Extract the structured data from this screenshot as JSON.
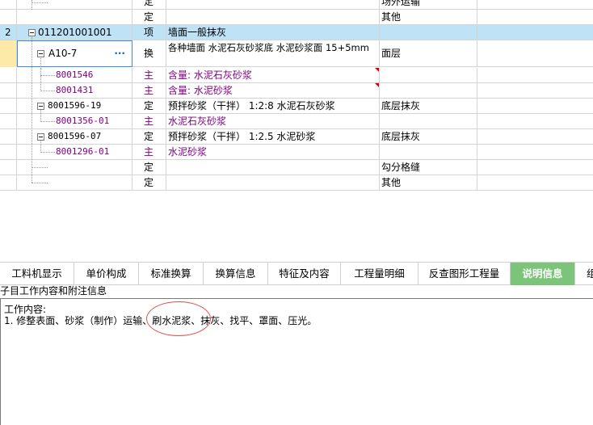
{
  "grid": {
    "rows": [
      {
        "num": "",
        "code": "",
        "type": "定",
        "name": "",
        "feature": "场外运输",
        "purple": false
      },
      {
        "num": "",
        "code": "",
        "type": "定",
        "name": "",
        "feature": "其他",
        "purple": false
      },
      {
        "num": "2",
        "code": "011201001001",
        "type": "项",
        "name": "墙面一般抹灰",
        "feature": "",
        "purple": false
      },
      {
        "num": "",
        "code": "A10-7",
        "type": "换",
        "name": "各种墙面 水泥石灰砂浆底 水泥砂浆面 15+5mm",
        "feature": "面层",
        "purple": false,
        "more_label": "···"
      },
      {
        "num": "",
        "code": "8001546",
        "type": "主",
        "name": "含量: 水泥石灰砂浆",
        "feature": "",
        "purple": true
      },
      {
        "num": "",
        "code": "8001431",
        "type": "主",
        "name": "含量: 水泥砂浆",
        "feature": "",
        "purple": true
      },
      {
        "num": "",
        "code": "8001596-19",
        "type": "定",
        "name": "预拌砂浆（干拌） 1:2:8 水泥石灰砂浆",
        "feature": "底层抹灰",
        "purple": false
      },
      {
        "num": "",
        "code": "8001356-01",
        "type": "主",
        "name": "水泥石灰砂浆",
        "feature": "",
        "purple": true
      },
      {
        "num": "",
        "code": "8001596-07",
        "type": "定",
        "name": "预拌砂浆（干拌） 1:2.5 水泥砂浆",
        "feature": "底层抹灰",
        "purple": false
      },
      {
        "num": "",
        "code": "8001296-01",
        "type": "主",
        "name": "水泥砂浆",
        "feature": "",
        "purple": true
      },
      {
        "num": "",
        "code": "",
        "type": "定",
        "name": "",
        "feature": "勾分格缝",
        "purple": false
      },
      {
        "num": "",
        "code": "",
        "type": "定",
        "name": "",
        "feature": "其他",
        "purple": false
      }
    ]
  },
  "tabs": [
    {
      "label": "工料机显示",
      "active": false
    },
    {
      "label": "单价构成",
      "active": false
    },
    {
      "label": "标准换算",
      "active": false
    },
    {
      "label": "换算信息",
      "active": false
    },
    {
      "label": "特征及内容",
      "active": false
    },
    {
      "label": "工程量明细",
      "active": false
    },
    {
      "label": "反查图形工程量",
      "active": false
    },
    {
      "label": "说明信息",
      "active": true
    },
    {
      "label": "组",
      "active": false
    }
  ],
  "info": {
    "title": "子目工作内容和附注信息",
    "heading": "工作内容:",
    "content": "1. 修整表面、砂浆（制作）运输、刷水泥浆、抹灰、找平、罩面、压光。"
  },
  "colors": {
    "selected_row": "#bfe3f6",
    "active_tab": "#7cc47a",
    "purple_text": "#800080",
    "annotation": "#e05050"
  }
}
